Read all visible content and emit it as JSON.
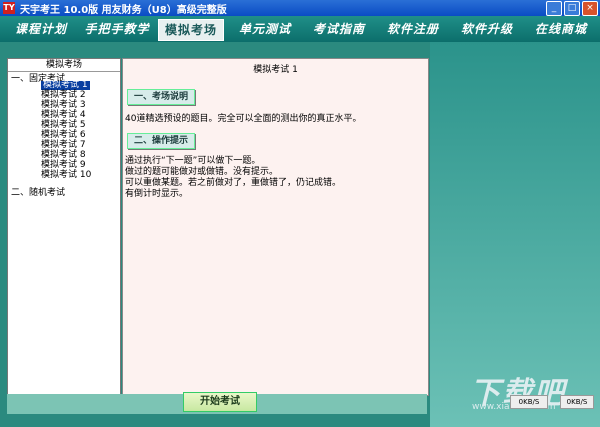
{
  "window": {
    "title": "天宇考王 10.0版 用友财务（U8）高级完整版",
    "icon_text": "TY"
  },
  "menu": [
    {
      "label": "课程计划"
    },
    {
      "label": "手把手教学"
    },
    {
      "label": "模拟考场"
    },
    {
      "label": "单元测试"
    },
    {
      "label": "考试指南"
    },
    {
      "label": "软件注册"
    },
    {
      "label": "软件升级"
    },
    {
      "label": "在线商城"
    }
  ],
  "sidebar": {
    "header": "模拟考场",
    "section1": "一、固定考试",
    "items": [
      "模拟考试 1",
      "模拟考试 2",
      "模拟考试 3",
      "模拟考试 4",
      "模拟考试 5",
      "模拟考试 6",
      "模拟考试 7",
      "模拟考试 8",
      "模拟考试 9",
      "模拟考试 10"
    ],
    "section2": "二、随机考试"
  },
  "main": {
    "title": "模拟考试 1",
    "section1": "一、考场说明",
    "desc": "40道精选预设的题目。完全可以全面的测出你的真正水平。",
    "section2": "二、操作提示",
    "tips": [
      "通过执行“下一题”可以做下一题。",
      "做过的题可能做对或做错。没有提示。",
      "可以重做某题。若之前做对了，重做错了，仍记成错。",
      "有倒计时显示。"
    ]
  },
  "start_button": "开始考试",
  "watermark": {
    "text": "下载吧",
    "url": "www.xiazaiba.com"
  },
  "speed": {
    "a": "0KB/S",
    "b": "0KB/S"
  }
}
